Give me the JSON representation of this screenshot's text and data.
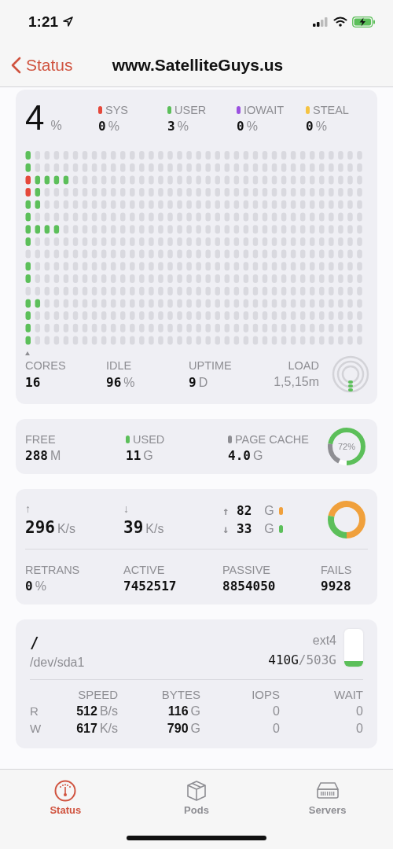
{
  "status_bar": {
    "time": "1:21"
  },
  "nav": {
    "back": "Status",
    "title": "www.SatelliteGuys.us"
  },
  "cpu": {
    "total": {
      "value": "4",
      "unit": "%"
    },
    "stats": [
      {
        "label": "SYS",
        "value": "0",
        "unit": "%",
        "color": "#e5483b"
      },
      {
        "label": "USER",
        "value": "3",
        "unit": "%",
        "color": "#5cbf5a"
      },
      {
        "label": "IOWAIT",
        "value": "0",
        "unit": "%",
        "color": "#9b51e0"
      },
      {
        "label": "STEAL",
        "value": "0",
        "unit": "%",
        "color": "#f5c342"
      }
    ],
    "summary": [
      {
        "label": "CORES",
        "value": "16",
        "kind": "stat"
      },
      {
        "label": "IDLE",
        "value": "96",
        "unit": "%",
        "kind": "stat"
      },
      {
        "label": "UPTIME",
        "value": "9",
        "unit": "D",
        "kind": "stat"
      },
      {
        "label": "LOAD",
        "value": "1,5,15m",
        "kind": "caption"
      }
    ]
  },
  "memory": {
    "stats": [
      {
        "label": "FREE",
        "value": "288",
        "unit": "M"
      },
      {
        "label": "USED",
        "value": "11",
        "unit": "G",
        "color": "#5cbf5a"
      },
      {
        "label": "PAGE CACHE",
        "value": "4.0",
        "unit": "G",
        "color": "#8e8e93"
      }
    ],
    "donut": {
      "label": "72%",
      "segments": [
        {
          "color": "#5cbf5a",
          "level": 0.72
        },
        {
          "color": "#8e8e93",
          "level": 0.2
        }
      ]
    }
  },
  "network": {
    "rates": [
      {
        "arrow": "↑",
        "value": "296",
        "unit": "K/s"
      },
      {
        "arrow": "↓",
        "value": "39",
        "unit": "K/s"
      }
    ],
    "totals": [
      {
        "arrow": "↑",
        "value": "82",
        "unit": "G",
        "color": "#f0a03c"
      },
      {
        "arrow": "↓",
        "value": "33",
        "unit": "G",
        "color": "#5cbf5a"
      }
    ],
    "donut": {
      "segments": [
        {
          "color": "#f0a03c",
          "level": 0.71
        },
        {
          "color": "#5cbf5a",
          "level": 0.29
        }
      ]
    },
    "tcp": [
      {
        "label": "RETRANS",
        "value": "0",
        "unit": "%"
      },
      {
        "label": "ACTIVE",
        "value": "7452517"
      },
      {
        "label": "PASSIVE",
        "value": "8854050"
      },
      {
        "label": "FAILS",
        "value": "9928"
      }
    ]
  },
  "disk": {
    "mount": "/",
    "device": "/dev/sda1",
    "fs": "ext4",
    "used": "410G",
    "total": "/503G",
    "columns": [
      "SPEED",
      "BYTES",
      "IOPS",
      "WAIT"
    ],
    "rows": [
      {
        "label": "R",
        "speed": {
          "value": "512",
          "unit": "B/s"
        },
        "bytes": {
          "value": "116",
          "unit": "G"
        },
        "iops": "0",
        "wait": "0"
      },
      {
        "label": "W",
        "speed": {
          "value": "617",
          "unit": "K/s"
        },
        "bytes": {
          "value": "790",
          "unit": "G"
        },
        "iops": "0",
        "wait": "0"
      }
    ]
  },
  "tabs": [
    {
      "label": "Status",
      "kind": "gauge",
      "selected": true
    },
    {
      "label": "Pods",
      "kind": "box",
      "selected": false
    },
    {
      "label": "Servers",
      "kind": "server",
      "selected": false
    }
  ]
}
